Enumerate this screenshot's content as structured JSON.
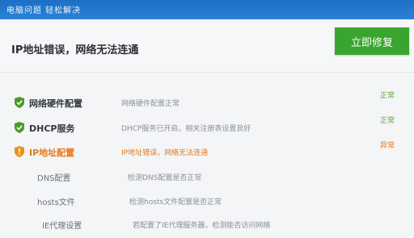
{
  "window": {
    "title": "电脑问题 轻松解决"
  },
  "header": {
    "headline": "IP地址错误，网络无法连通",
    "fix_button": "立即修复"
  },
  "colors": {
    "accent_blue": "#1d6fc4",
    "button_green": "#3aa52e",
    "ok_green": "#5aa73c",
    "error_orange": "#e07a1f"
  },
  "checks": [
    {
      "name": "网络硬件配置",
      "desc": "网络硬件配置正常",
      "status": "正常",
      "state": "ok",
      "icon": "green-shield-check-icon"
    },
    {
      "name": "DHCP服务",
      "desc": "DHCP服务已开启，相关注册表设置良好",
      "status": "正常",
      "state": "ok",
      "icon": "green-shield-check-icon"
    },
    {
      "name": "IP地址配置",
      "desc": "IP地址错误，网络无法连通",
      "status": "异常",
      "state": "error",
      "icon": "orange-shield-warning-icon"
    },
    {
      "name": "DNS配置",
      "desc": "检测DNS配置是否正常"
    },
    {
      "name": "hosts文件",
      "desc": "检测hosts文件配置是否正常"
    },
    {
      "name": "IE代理设置",
      "desc": "若配置了IE代理服务器，检测能否访问网络"
    }
  ]
}
